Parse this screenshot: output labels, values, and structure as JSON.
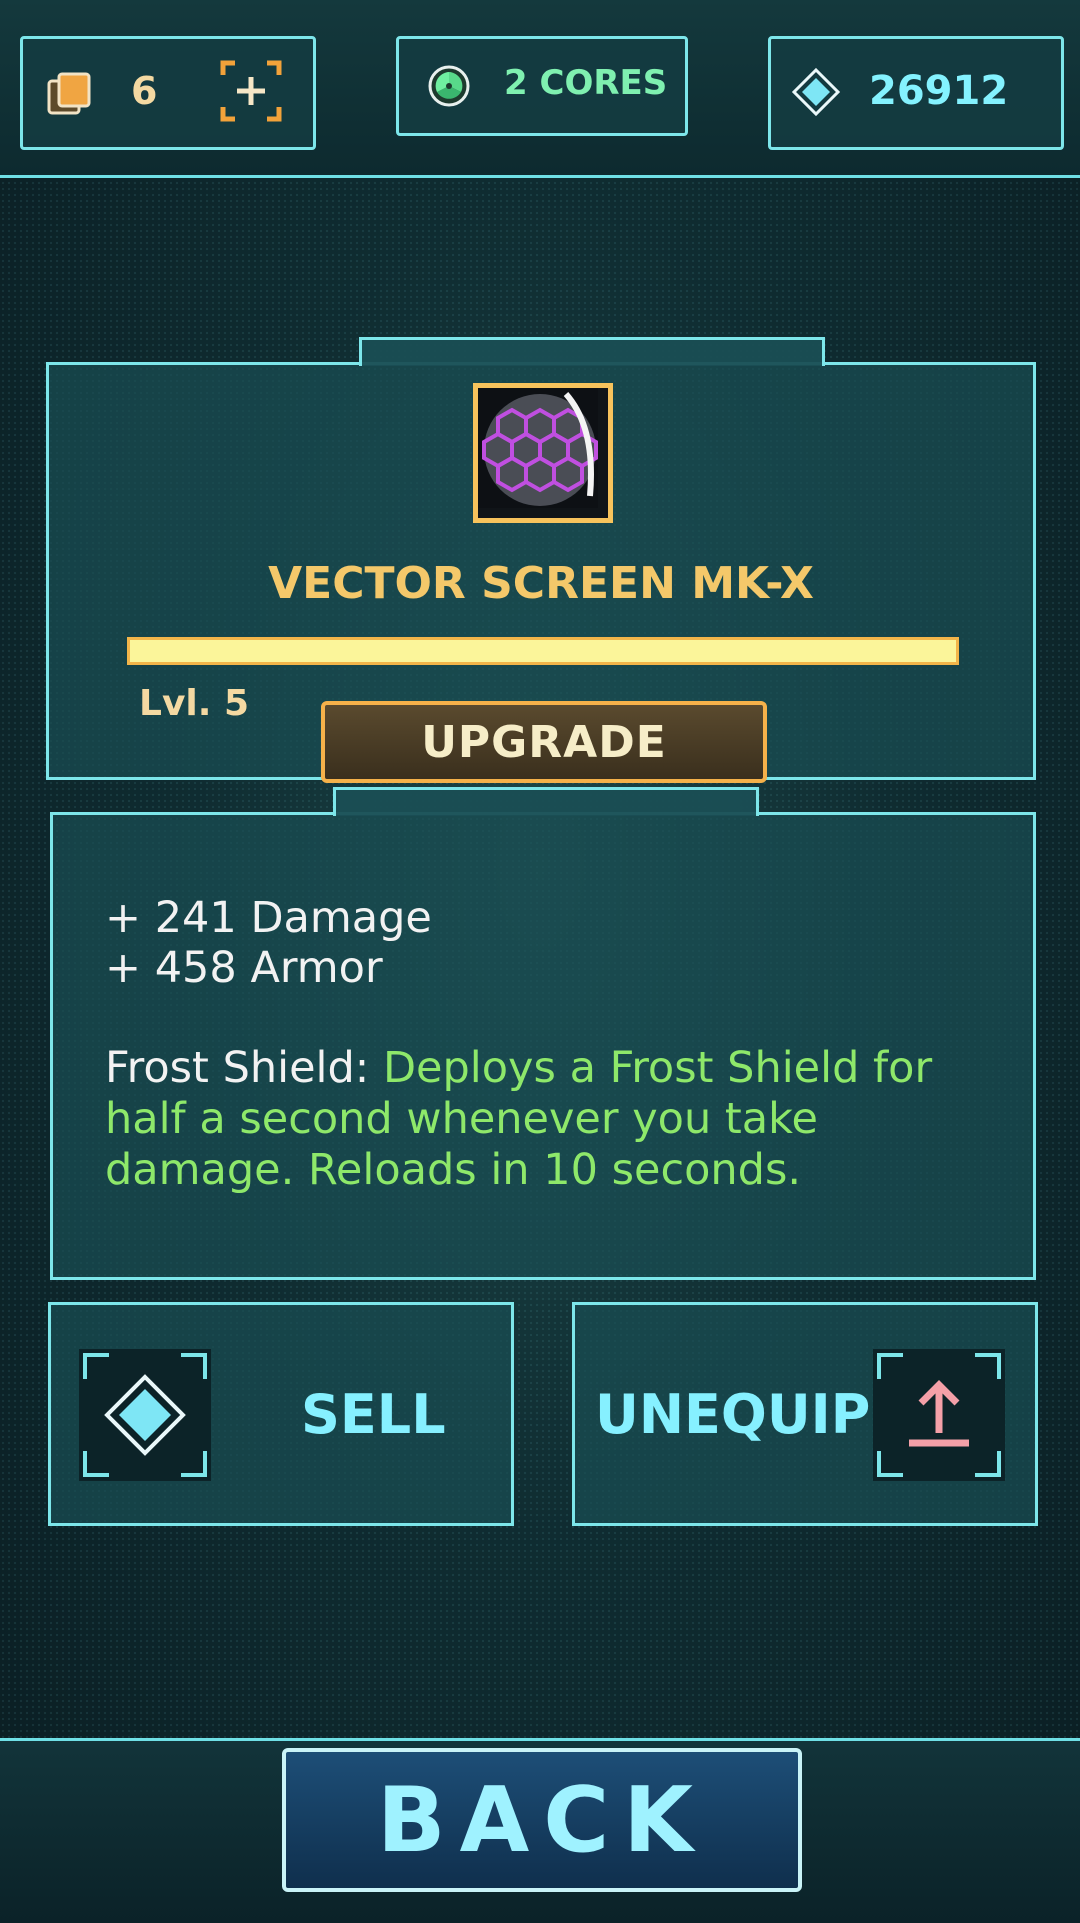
{
  "hud": {
    "cards_count": "6",
    "cores_label": "2 CORES",
    "gems_count": "26912"
  },
  "item": {
    "name": "VECTOR SCREEN MK-X",
    "level_label": "Lvl. 5",
    "xp_progress": 1.0,
    "upgrade_label": "UPGRADE"
  },
  "stats": {
    "damage": "+ 241 Damage",
    "armor": "+ 458 Armor",
    "ability_name": "Frost Shield: ",
    "ability_desc": "Deploys a Frost Shield for half a second whenever you take damage. Reloads in 10 seconds."
  },
  "actions": {
    "sell_label": "SELL",
    "unequip_label": "UNEQUIP"
  },
  "back_label": "BACK",
  "colors": {
    "accent": "#7de6ea",
    "gold": "#f4c86a",
    "ability_green": "#8ee86a"
  }
}
